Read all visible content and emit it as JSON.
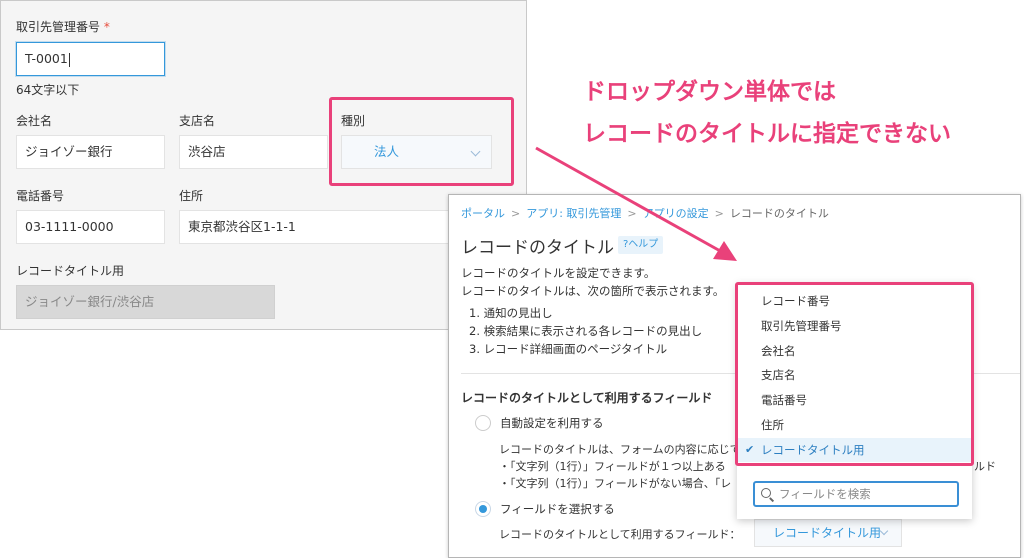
{
  "form": {
    "client_no": {
      "label": "取引先管理番号",
      "required_mark": "*",
      "value": "T-0001",
      "hint": "64文字以下"
    },
    "company": {
      "label": "会社名",
      "value": "ジョイゾー銀行"
    },
    "branch": {
      "label": "支店名",
      "value": "渋谷店"
    },
    "type": {
      "label": "種別",
      "value": "法人"
    },
    "phone": {
      "label": "電話番号",
      "value": "03-1111-0000"
    },
    "address": {
      "label": "住所",
      "value": "東京都渋谷区1-1-1"
    },
    "record_title": {
      "label": "レコードタイトル用",
      "value": "ジョイゾー銀行/渋谷店"
    }
  },
  "annotation": {
    "line1": "ドロップダウン単体では",
    "line2": "レコードのタイトルに指定できない",
    "color": "#e9417a"
  },
  "settings": {
    "breadcrumb": {
      "portal": "ポータル",
      "app": "アプリ: 取引先管理",
      "app_settings": "アプリの設定",
      "current": "レコードのタイトル",
      "separator": ">"
    },
    "title": "レコードのタイトル",
    "help": "?ヘルプ",
    "desc1": "レコードのタイトルを設定できます。",
    "desc2": "レコードのタイトルは、次の箇所で表示されます。",
    "list": [
      "1. 通知の見出し",
      "2. 検索結果に表示される各レコードの見出し",
      "3. レコード詳細画面のページタイトル"
    ],
    "section_title": "レコードのタイトルとして利用するフィールド",
    "radio_auto": "自動設定を利用する",
    "auto_desc1": "レコードのタイトルは、フォームの内容に応じてﾚ",
    "auto_desc2": "・「文字列（1行）」フィールドが１つ以上ある",
    "auto_desc2_tail": "ルド",
    "auto_desc3": "・「文字列（1行）」フィールドがない場合、「レ",
    "radio_select": "フィールドを選択する",
    "select_label": "レコードのタイトルとして利用するフィールド：",
    "select_value": "レコードタイトル用"
  },
  "dropdown": {
    "options": [
      "レコード番号",
      "取引先管理番号",
      "会社名",
      "支店名",
      "電話番号",
      "住所",
      "レコードタイトル用"
    ],
    "selected_index": 6,
    "search_placeholder": "フィールドを検索"
  },
  "accent_color": "#3498db",
  "highlight_color": "#e9417a"
}
